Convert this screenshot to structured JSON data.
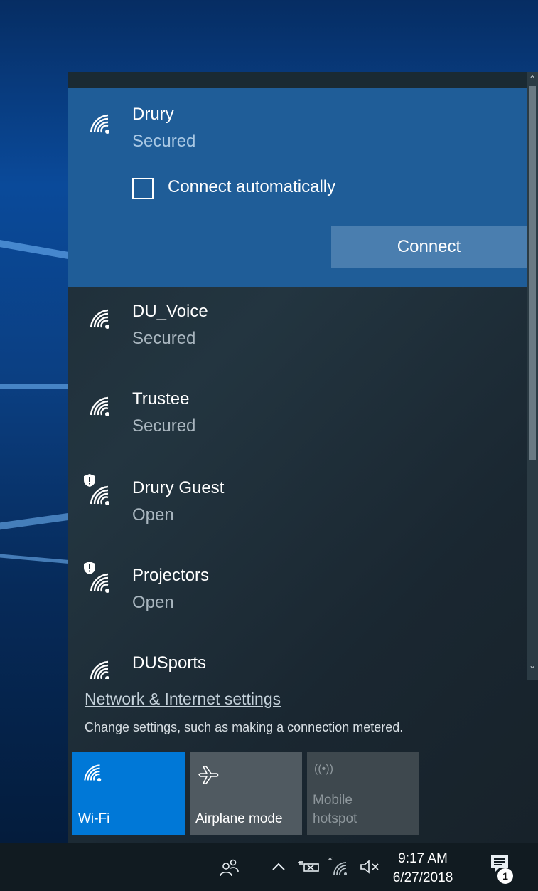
{
  "networks": [
    {
      "name": "Drury",
      "status": "Secured",
      "shield": false
    },
    {
      "name": "DU_Voice",
      "status": "Secured",
      "shield": false
    },
    {
      "name": "Trustee",
      "status": "Secured",
      "shield": false
    },
    {
      "name": "Drury Guest",
      "status": "Open",
      "shield": true
    },
    {
      "name": "Projectors",
      "status": "Open",
      "shield": true
    },
    {
      "name": "DUSports",
      "status": "",
      "shield": false
    }
  ],
  "selected": {
    "connect_auto_label": "Connect automatically",
    "connect_auto_checked": false,
    "connect_label": "Connect"
  },
  "settings": {
    "link": "Network & Internet settings",
    "description": "Change settings, such as making a connection metered."
  },
  "tiles": [
    {
      "label": "Wi-Fi",
      "active": true,
      "icon": "wifi-icon"
    },
    {
      "label": "Airplane mode",
      "active": false,
      "icon": "airplane-icon"
    },
    {
      "label_line1": "Mobile",
      "label_line2": "hotspot",
      "active": false,
      "disabled": true,
      "icon": "hotspot-icon"
    }
  ],
  "taskbar": {
    "time": "9:17 AM",
    "date": "6/27/2018",
    "notification_count": "1"
  },
  "colors": {
    "accent": "#0078d7",
    "selected_bg": "#1f5d98",
    "flyout_bg": "#1d2b35"
  }
}
